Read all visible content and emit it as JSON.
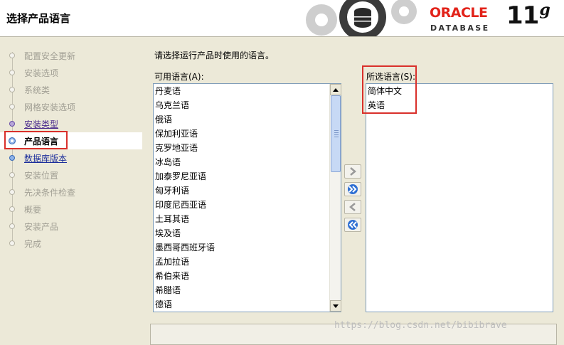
{
  "header": {
    "title": "选择产品语言",
    "logo_oracle": "ORACLE",
    "logo_db": "DATABASE",
    "logo_version": "11",
    "logo_version_sup": "g"
  },
  "nav": {
    "items": [
      {
        "label": "配置安全更新",
        "state": "disabled"
      },
      {
        "label": "安装选项",
        "state": "disabled"
      },
      {
        "label": "系统类",
        "state": "disabled"
      },
      {
        "label": "网格安装选项",
        "state": "disabled"
      },
      {
        "label": "安装类型",
        "state": "visited"
      },
      {
        "label": "产品语言",
        "state": "current"
      },
      {
        "label": "数据库版本",
        "state": "next"
      },
      {
        "label": "安装位置",
        "state": "disabled"
      },
      {
        "label": "先决条件检查",
        "state": "disabled"
      },
      {
        "label": "概要",
        "state": "disabled"
      },
      {
        "label": "安装产品",
        "state": "disabled"
      },
      {
        "label": "完成",
        "state": "disabled"
      }
    ]
  },
  "main": {
    "instruction": "请选择运行产品时使用的语言。",
    "available_label": "可用语言(A):",
    "selected_label": "所选语言(S):",
    "available_languages": [
      "丹麦语",
      "乌克兰语",
      "俄语",
      "保加利亚语",
      "克罗地亚语",
      "冰岛语",
      "加泰罗尼亚语",
      "匈牙利语",
      "印度尼西亚语",
      "土耳其语",
      "埃及语",
      "墨西哥西班牙语",
      "孟加拉语",
      "希伯来语",
      "希腊语",
      "德语"
    ],
    "selected_languages": [
      "简体中文",
      "英语"
    ]
  },
  "watermark": "https://blog.csdn.net/bibibrave",
  "colors": {
    "highlight_border": "#d9302b",
    "oracle_red": "#e2231a",
    "background": "#ece9d8"
  }
}
